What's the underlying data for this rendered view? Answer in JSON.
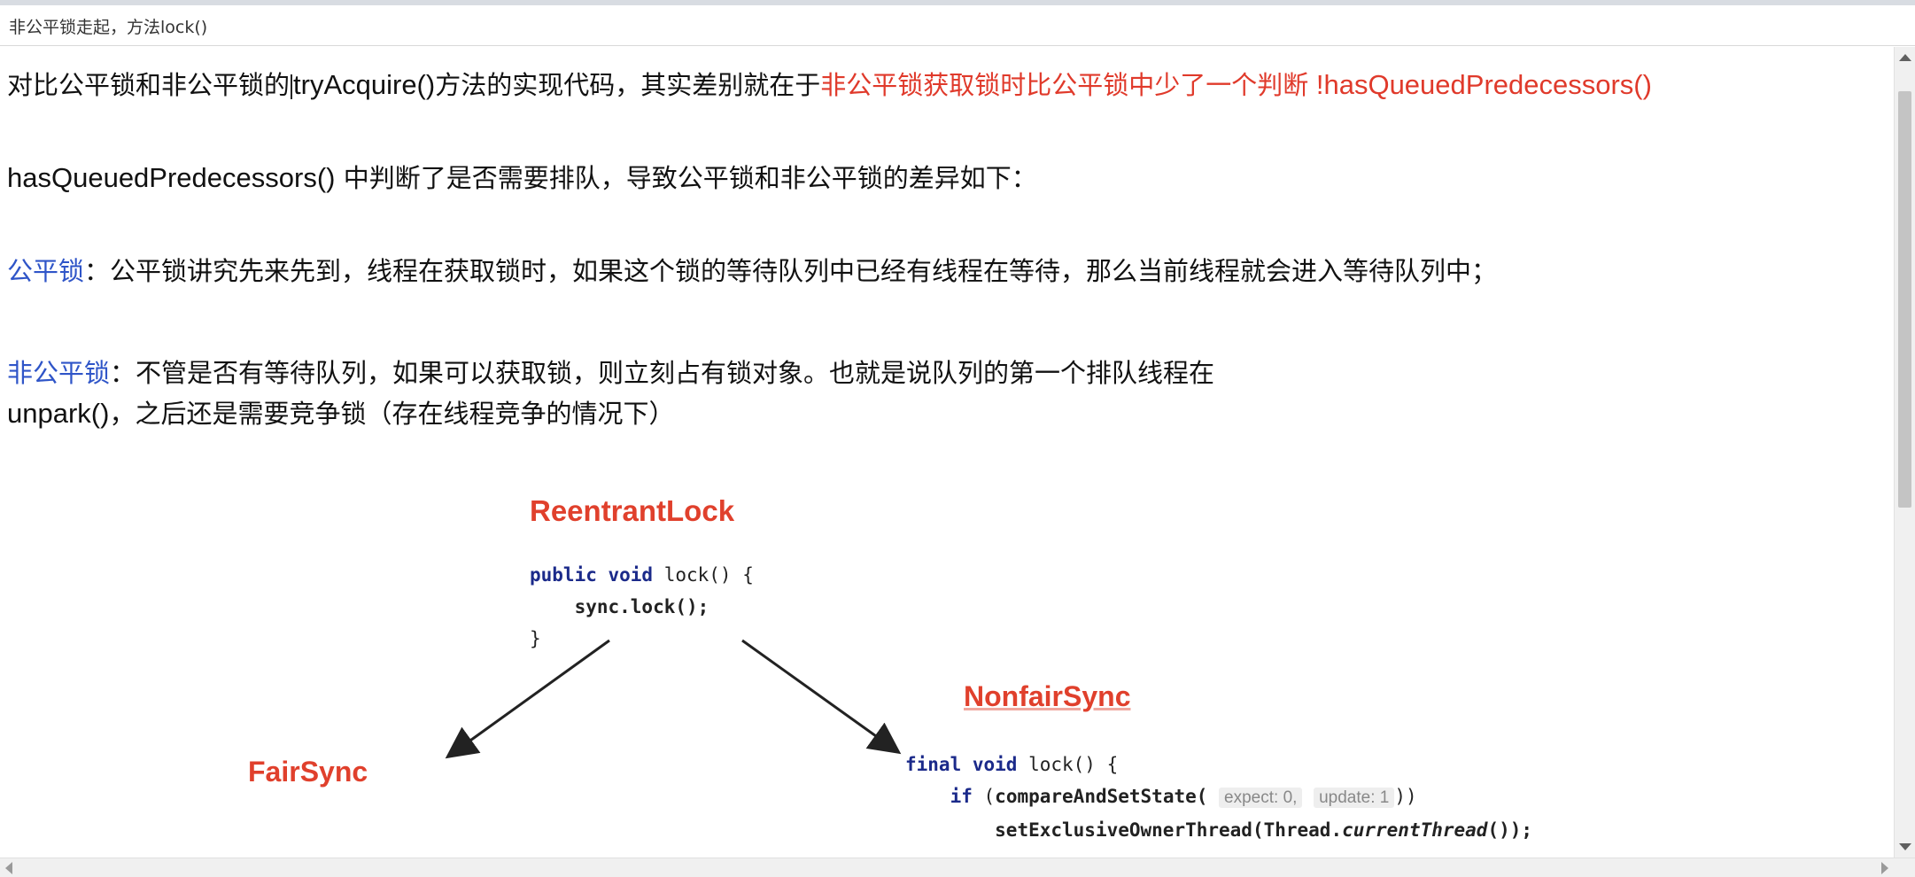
{
  "window": {
    "title": "非公平锁走起，方法lock()"
  },
  "paragraphs": {
    "p1": {
      "a": "对比公平锁和非公平锁的",
      "b": "tryAcquire()",
      "c": "方法的实现代码，其实差别就在于",
      "d": "非公平锁获取锁时比公平锁中少了一个判断",
      "e": " !hasQueuedPredecessors()"
    },
    "p2": {
      "a": "hasQueuedPredecessors()",
      "b": " 中判断了是否需要排队，导致公平锁和非公平锁的差异如下："
    },
    "p3": {
      "term": "公平锁",
      "text": "：公平锁讲究先来先到，线程在获取锁时，如果这个锁的等待队列中已经有线程在等待，那么当前线程就会进入等待队列中；"
    },
    "p4": {
      "term": "非公平锁",
      "a": "：不管是否有等待队列，如果可以获取锁，则立刻占有锁对象。也就是说队列的第一个排队线程在",
      "b": "unpark()",
      "c": "，之后还是需要竞争锁（存在线程竞争的情况下）"
    }
  },
  "figure": {
    "reentrant_title": "ReentrantLock",
    "reentrant_code": {
      "l1_kw": "public void",
      "l1_rest": " lock() {",
      "l2": "sync.lock();",
      "l3": "}"
    },
    "fair_title": "FairSync",
    "nonfair_title": "NonfairSync",
    "nonfair_code": {
      "l1_kw": "final void",
      "l1_rest": " lock() {",
      "l2_kw": "if",
      "l2_a": " (",
      "l2_method": "compareAndSetState(",
      "hint_expect": "expect: 0,",
      "hint_update": "update: 1",
      "l2_end": "))",
      "l3_a": "setExclusiveOwnerThread(Thread.",
      "l3_italic": "currentThread",
      "l3_b": "());"
    }
  },
  "colors": {
    "accent_red": "#e03a2b",
    "term_blue": "#2f55c8",
    "keyword_navy": "#1b2a8a"
  }
}
